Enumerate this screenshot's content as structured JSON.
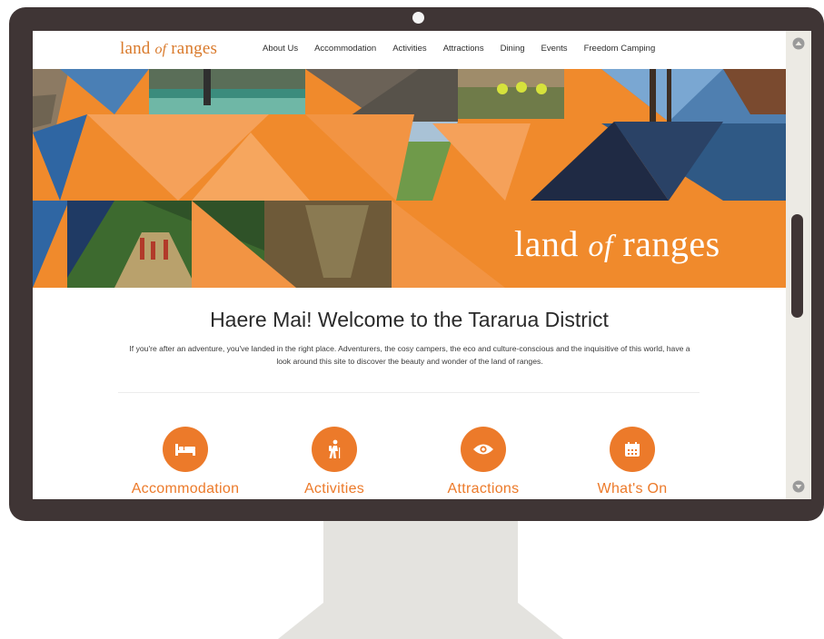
{
  "site": {
    "logo": {
      "part1": "land ",
      "part2": "of",
      "part3": " ranges"
    },
    "nav": [
      "About Us",
      "Accommodation",
      "Activities",
      "Attractions",
      "Dining",
      "Events",
      "Freedom Camping"
    ],
    "hero_title": {
      "part1": "land ",
      "part2": "of",
      "part3": " ranges"
    },
    "welcome": {
      "title": "Haere Mai! Welcome to the Tararua District",
      "text": "If you're after an adventure, you've landed in the right place. Adventurers, the cosy campers, the eco and culture-conscious and the inquisitive of this world, have a look around this site to discover the beauty and wonder of the land of ranges."
    },
    "features": [
      {
        "label": "Accommodation",
        "icon": "bed-icon"
      },
      {
        "label": "Activities",
        "icon": "hiker-icon"
      },
      {
        "label": "Attractions",
        "icon": "eye-icon"
      },
      {
        "label": "What's On",
        "icon": "calendar-icon"
      }
    ]
  },
  "colors": {
    "brand_orange": "#f08a2c",
    "bezel": "#3f3535",
    "stand": "#e4e3df"
  }
}
